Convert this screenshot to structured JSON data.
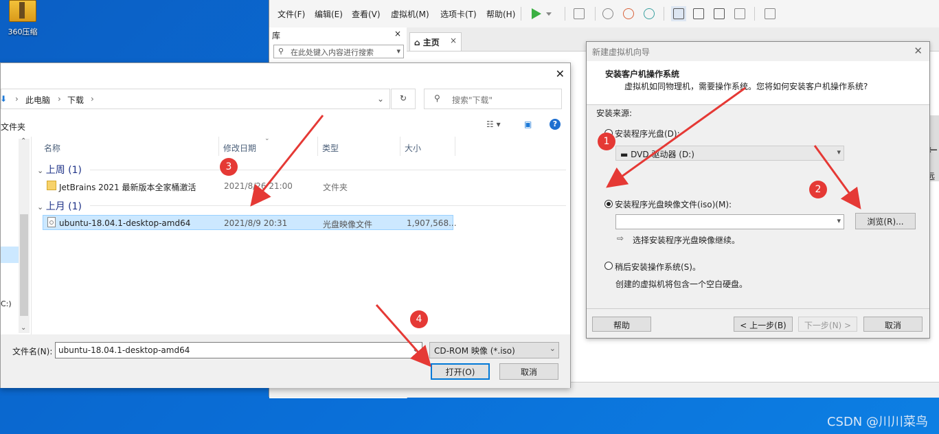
{
  "desktop": {
    "icon_label": "360压缩",
    "watermark": "CSDN @川川菜鸟"
  },
  "vmware": {
    "menu": [
      "文件(F)",
      "编辑(E)",
      "查看(V)",
      "虚拟机(M)",
      "选项卡(T)",
      "帮助(H)"
    ],
    "library": {
      "title": "库",
      "close": "×",
      "search_placeholder": "在此处键入内容进行搜索"
    },
    "tab_home": "主页",
    "tab_close": "×",
    "side_text": "远"
  },
  "wizard": {
    "title": "新建虚拟机向导",
    "heading": "安装客户机操作系统",
    "subheading": "虚拟机如同物理机，需要操作系统。您将如何安装客户机操作系统?",
    "source_label": "安装来源:",
    "option_disc": "安装程序光盘(D):",
    "disc_value": "DVD 驱动器 (D:)",
    "option_iso": "安装程序光盘映像文件(iso)(M):",
    "iso_value": "",
    "browse_button": "浏览(R)...",
    "iso_hint": "选择安装程序光盘映像继续。",
    "option_later": "稍后安装操作系统(S)。",
    "later_hint": "创建的虚拟机将包含一个空白硬盘。",
    "help_button": "帮助",
    "back_button": "< 上一步(B)",
    "next_button": "下一步(N) >",
    "cancel_button": "取消"
  },
  "file_dialog": {
    "breadcrumb": [
      "此电脑",
      "下载"
    ],
    "search_placeholder": "搜索\"下载\"",
    "toolbar_left": "文件夹",
    "columns": [
      "名称",
      "修改日期",
      "类型",
      "大小"
    ],
    "groups": [
      {
        "label": "上周 (1)",
        "items": [
          {
            "name": "JetBrains 2021 最新版本全家桶激活",
            "date": "2021/8/26 21:00",
            "type": "文件夹",
            "size": ""
          }
        ]
      },
      {
        "label": "上月 (1)",
        "items": [
          {
            "name": "ubuntu-18.04.1-desktop-amd64",
            "date": "2021/8/9 20:31",
            "type": "光盘映像文件",
            "size": "1,907,568..."
          }
        ]
      }
    ],
    "nav_fragment": "C:)",
    "filename_label": "文件名(N):",
    "filename_value": "ubuntu-18.04.1-desktop-amd64",
    "filetype_value": "CD-ROM 映像 (*.iso)",
    "open_button": "打开(O)",
    "cancel_button": "取消"
  },
  "annotations": [
    "1",
    "2",
    "3",
    "4"
  ],
  "colors": {
    "annotation": "#e53935",
    "selection": "#cce8ff",
    "accent": "#0078d7"
  }
}
